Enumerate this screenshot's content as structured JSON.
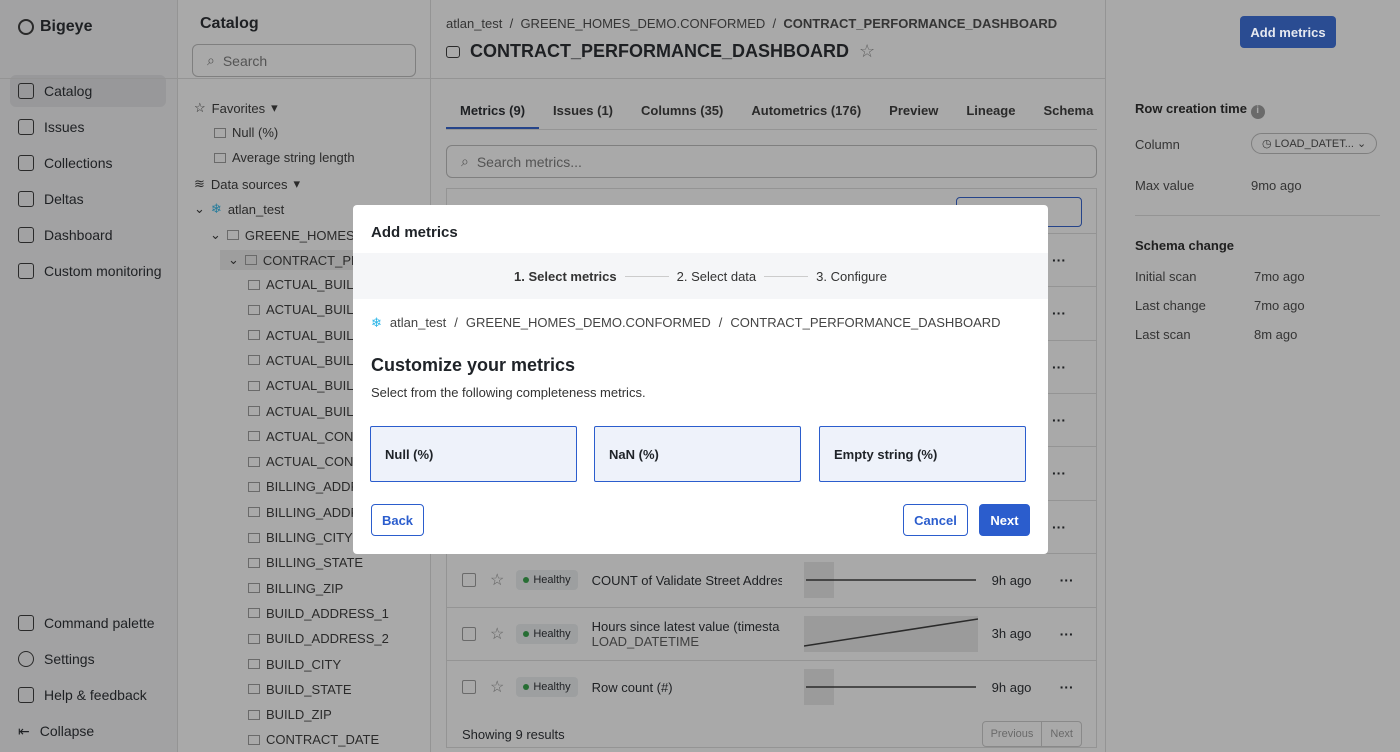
{
  "nav": {
    "brand": "Bigeye",
    "items": [
      "Catalog",
      "Issues",
      "Collections",
      "Deltas",
      "Dashboard",
      "Custom monitoring"
    ],
    "bottom": [
      "Command palette",
      "Settings",
      "Help & feedback",
      "Collapse"
    ]
  },
  "catalog": {
    "title": "Catalog",
    "search_placeholder": "Search",
    "favorites": "Favorites",
    "fav_items": [
      "Null (%)",
      "Average string length"
    ],
    "data_sources": "Data sources",
    "source": "atlan_test",
    "schema": "GREENE_HOMES_",
    "table": "CONTRACT_PE",
    "columns": [
      "ACTUAL_BUILD",
      "ACTUAL_BUILD",
      "ACTUAL_BUILD",
      "ACTUAL_BUILD",
      "ACTUAL_BUILD",
      "ACTUAL_BUILD",
      "ACTUAL_CONT",
      "ACTUAL_CONT",
      "BILLING_ADDR",
      "BILLING_ADDR",
      "BILLING_CITY",
      "BILLING_STATE",
      "BILLING_ZIP",
      "BUILD_ADDRESS_1",
      "BUILD_ADDRESS_2",
      "BUILD_CITY",
      "BUILD_STATE",
      "BUILD_ZIP",
      "CONTRACT_DATE"
    ]
  },
  "header": {
    "crumbs": [
      "atlan_test",
      "GREENE_HOMES_DEMO.CONFORMED",
      "CONTRACT_PERFORMANCE_DASHBOARD"
    ],
    "title": "CONTRACT_PERFORMANCE_DASHBOARD",
    "add_metrics": "Add metrics"
  },
  "tabs": [
    "Metrics (9)",
    "Issues (1)",
    "Columns (35)",
    "Autometrics (176)",
    "Preview",
    "Lineage",
    "Schema cha"
  ],
  "metrics_search_placeholder": "Search metrics...",
  "rows": [
    {
      "status": "Healthy",
      "name": "COUNT of Validate Street Addres",
      "sub": "",
      "ago": "9h ago"
    },
    {
      "status": "Healthy",
      "name": "Hours since latest value (timesta",
      "sub": "LOAD_DATETIME",
      "ago": "3h ago"
    },
    {
      "status": "Healthy",
      "name": "Row count (#)",
      "sub": "",
      "ago": "9h ago"
    }
  ],
  "footer": {
    "showing": "Showing 9 results",
    "previous": "Previous",
    "next": "Next"
  },
  "right": {
    "row_creation": "Row creation time",
    "column_label": "Column",
    "column_value": "LOAD_DATET...",
    "max_label": "Max value",
    "max_value": "9mo ago",
    "schema_change": "Schema change",
    "items": [
      [
        "Initial scan",
        "7mo ago"
      ],
      [
        "Last change",
        "7mo ago"
      ],
      [
        "Last scan",
        "8m ago"
      ]
    ]
  },
  "modal": {
    "title": "Add metrics",
    "steps": [
      "1. Select metrics",
      "2. Select data",
      "3. Configure"
    ],
    "crumbs": [
      "atlan_test",
      "/",
      "GREENE_HOMES_DEMO.CONFORMED",
      "/",
      "CONTRACT_PERFORMANCE_DASHBOARD"
    ],
    "heading": "Customize your metrics",
    "subtitle": "Select from the following completeness metrics.",
    "options": [
      "Null (%)",
      "NaN (%)",
      "Empty string (%)"
    ],
    "back": "Back",
    "cancel": "Cancel",
    "next": "Next"
  }
}
